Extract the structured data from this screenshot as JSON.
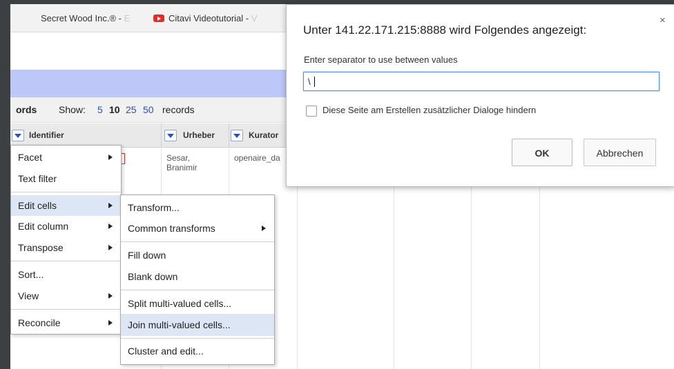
{
  "bookmarks": [
    {
      "text": "Secret Wood Inc.® - ",
      "fade": "E"
    },
    {
      "text": "Citavi Videotutorial - ",
      "fade": "V"
    }
  ],
  "toolbar": {
    "records_label": "ords",
    "show_label": "Show:",
    "page_sizes": [
      "5",
      "10",
      "25",
      "50"
    ],
    "records_suffix": "records"
  },
  "columns": {
    "identifier": "Identifier",
    "urheber": "Urheber",
    "kurator": "Kurator"
  },
  "row": {
    "urheber_line1": "Sesar,",
    "urheber_line2": "Branimir",
    "kurator": "openaire_da"
  },
  "column_menu": {
    "items": [
      "Facet",
      "Text filter",
      "Edit cells",
      "Edit column",
      "Transpose",
      "Sort...",
      "View",
      "Reconcile"
    ]
  },
  "edit_cells_submenu": {
    "items": [
      "Transform...",
      "Common transforms",
      "Fill down",
      "Blank down",
      "Split multi-valued cells...",
      "Join multi-valued cells...",
      "Cluster and edit..."
    ]
  },
  "dialog": {
    "title": "Unter 141.22.171.215:8888 wird Folgendes angezeigt:",
    "message": "Enter separator to use between values",
    "input_value": "\\",
    "checkbox_label": "Diese Seite am Erstellen zusätzlicher Dialoge hindern",
    "ok_label": "OK",
    "cancel_label": "Abbrechen",
    "close_glyph": "×"
  }
}
